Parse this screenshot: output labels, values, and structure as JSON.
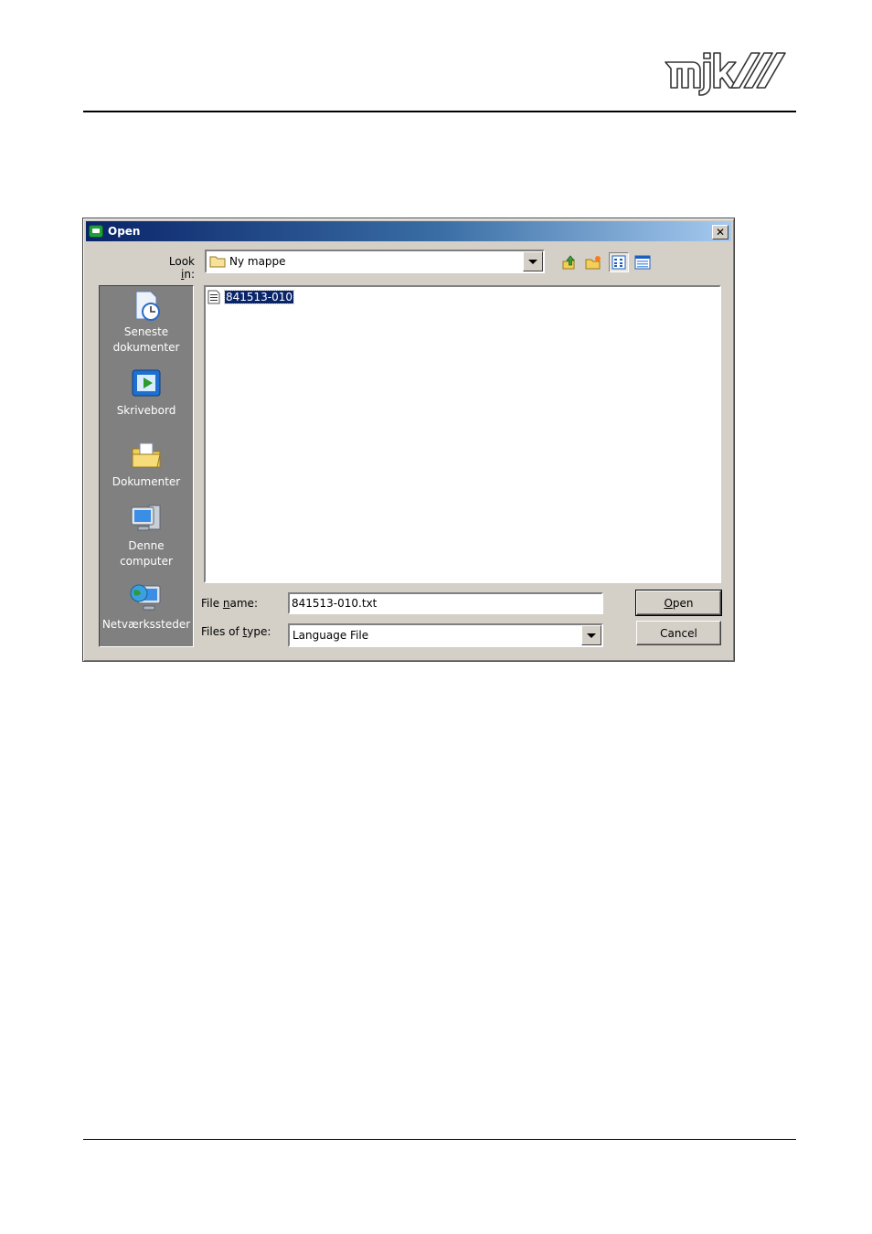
{
  "header": {
    "logo_text": "mjk"
  },
  "dialog": {
    "title": "Open",
    "close_label": "✕",
    "look_in": {
      "label_pre": "Look ",
      "label_accel": "i",
      "label_post": "n:",
      "value": "Ny mappe"
    },
    "toolbar": {
      "icons": [
        "up-one-level-icon",
        "create-new-folder-icon",
        "list-view-icon",
        "details-view-icon"
      ]
    },
    "places": [
      {
        "line1": "Seneste",
        "line2": "dokumenter",
        "icon": "recent-documents-icon"
      },
      {
        "line1": "Skrivebord",
        "line2": "",
        "icon": "desktop-icon"
      },
      {
        "line1": "Dokumenter",
        "line2": "",
        "icon": "my-documents-icon"
      },
      {
        "line1": "Denne",
        "line2": "computer",
        "icon": "my-computer-icon"
      },
      {
        "line1": "Netværkssteder",
        "line2": "",
        "icon": "network-places-icon"
      }
    ],
    "files": [
      {
        "name": "841513-010",
        "selected": true
      }
    ],
    "file_name": {
      "label_pre": "File ",
      "label_accel": "n",
      "label_post": "ame:",
      "value": "841513-010.txt"
    },
    "files_of_type": {
      "label_pre": "Files of ",
      "label_accel": "t",
      "label_post": "ype:",
      "value": "Language File"
    },
    "buttons": {
      "open_accel": "O",
      "open_rest": "pen",
      "cancel": "Cancel"
    }
  },
  "colors": {
    "title_gradient_start": "#0a246a",
    "title_gradient_end": "#a6caf0",
    "dialog_face": "#d4d0c8",
    "places_bar": "#808080",
    "selection": "#0a246a"
  }
}
